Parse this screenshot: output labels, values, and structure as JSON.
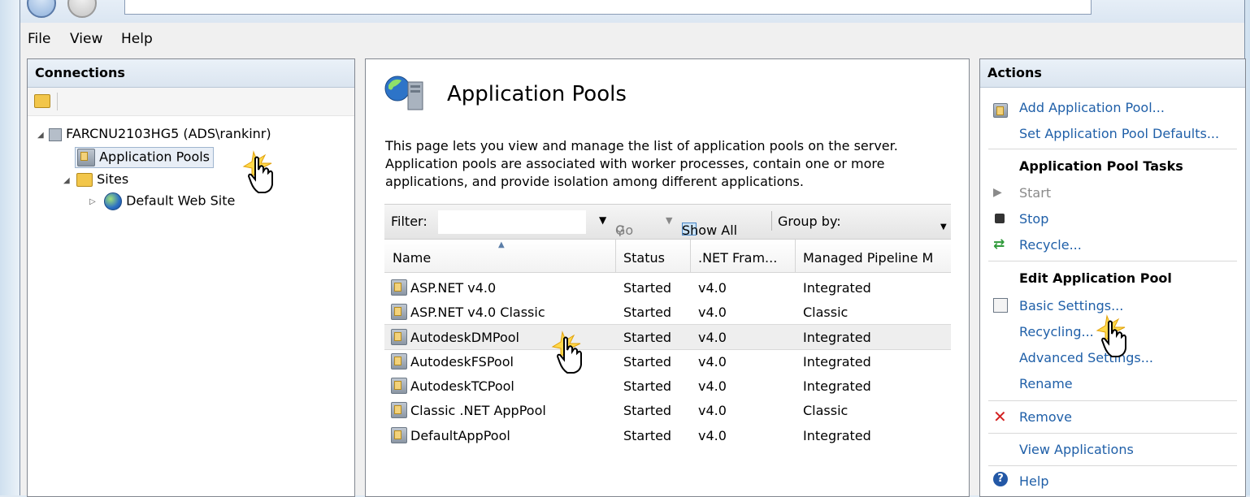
{
  "menu": {
    "file": "File",
    "view": "View",
    "help": "Help"
  },
  "connections": {
    "title": "Connections",
    "server": "FARCNU2103HG5 (ADS\\rankinr)",
    "app_pools": "Application Pools",
    "sites": "Sites",
    "default_site": "Default Web Site"
  },
  "main": {
    "title": "Application Pools",
    "description": [
      "This page lets you view and manage the list of application pools on the server.",
      "Application pools are associated with worker processes, contain one or more",
      "applications, and provide isolation among different applications."
    ],
    "filter_label": "Filter:",
    "go_label": "Go",
    "show_all_label": "Show All",
    "group_by_label": "Group by:",
    "columns": [
      "Name",
      "Status",
      ".NET Fram...",
      "Managed Pipeline M"
    ],
    "rows": [
      {
        "name": "ASP.NET v4.0",
        "status": "Started",
        "net": "v4.0",
        "pipeline": "Integrated"
      },
      {
        "name": "ASP.NET v4.0 Classic",
        "status": "Started",
        "net": "v4.0",
        "pipeline": "Classic"
      },
      {
        "name": "AutodeskDMPool",
        "status": "Started",
        "net": "v4.0",
        "pipeline": "Integrated"
      },
      {
        "name": "AutodeskFSPool",
        "status": "Started",
        "net": "v4.0",
        "pipeline": "Integrated"
      },
      {
        "name": "AutodeskTCPool",
        "status": "Started",
        "net": "v4.0",
        "pipeline": "Integrated"
      },
      {
        "name": "Classic .NET AppPool",
        "status": "Started",
        "net": "v4.0",
        "pipeline": "Classic"
      },
      {
        "name": "DefaultAppPool",
        "status": "Started",
        "net": "v4.0",
        "pipeline": "Integrated"
      }
    ]
  },
  "actions": {
    "title": "Actions",
    "add_pool": "Add Application Pool...",
    "set_defaults": "Set Application Pool Defaults...",
    "tasks_header": "Application Pool Tasks",
    "start": "Start",
    "stop": "Stop",
    "recycle": "Recycle...",
    "edit_header": "Edit Application Pool",
    "basic_settings": "Basic Settings...",
    "recycling": "Recycling...",
    "advanced_settings": "Advanced Settings...",
    "rename": "Rename",
    "remove": "Remove",
    "view_apps": "View Applications",
    "help": "Help"
  },
  "colors": {
    "link": "#1f5fa8",
    "remove_x": "#d32020",
    "stop": "#333333",
    "recycle": "#2f9a3a"
  }
}
